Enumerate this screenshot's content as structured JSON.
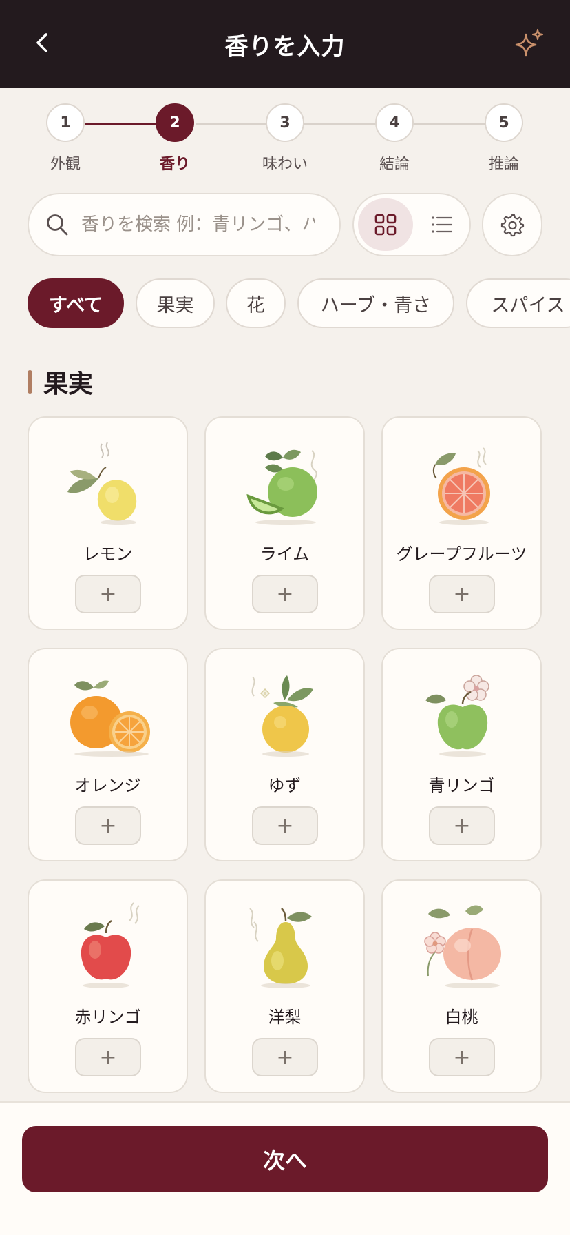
{
  "header": {
    "title": "香りを入力",
    "back_icon": "chevron-left-icon",
    "action_icon": "sparkle-icon"
  },
  "stepper": {
    "steps": [
      {
        "number": "1",
        "label": "外観"
      },
      {
        "number": "2",
        "label": "香り"
      },
      {
        "number": "3",
        "label": "味わい"
      },
      {
        "number": "4",
        "label": "結論"
      },
      {
        "number": "5",
        "label": "推論"
      }
    ],
    "active_index": 1
  },
  "search": {
    "placeholder": "香りを検索 例：青リンゴ、ハーブ"
  },
  "view_toggle": {
    "selected": "grid"
  },
  "categories": {
    "items": [
      {
        "label": "すべて",
        "active": true
      },
      {
        "label": "果実",
        "active": false
      },
      {
        "label": "花",
        "active": false
      },
      {
        "label": "ハーブ・青さ",
        "active": false
      },
      {
        "label": "スパイス",
        "active": false
      }
    ]
  },
  "section": {
    "title": "果実"
  },
  "aromas": [
    {
      "name": "レモン",
      "icon": "lemon-icon"
    },
    {
      "name": "ライム",
      "icon": "lime-icon"
    },
    {
      "name": "グレープフルーツ",
      "icon": "grapefruit-icon"
    },
    {
      "name": "オレンジ",
      "icon": "orange-icon"
    },
    {
      "name": "ゆず",
      "icon": "yuzu-icon"
    },
    {
      "name": "青リンゴ",
      "icon": "green-apple-icon"
    },
    {
      "name": "赤リンゴ",
      "icon": "red-apple-icon"
    },
    {
      "name": "洋梨",
      "icon": "pear-icon"
    },
    {
      "name": "白桃",
      "icon": "white-peach-icon"
    }
  ],
  "add_label": "+",
  "footer": {
    "next_label": "次へ"
  },
  "colors": {
    "accent": "#6b1a2a",
    "header_bg": "#231a1e",
    "background": "#f5f1ec",
    "section_bar": "#b07e62"
  }
}
